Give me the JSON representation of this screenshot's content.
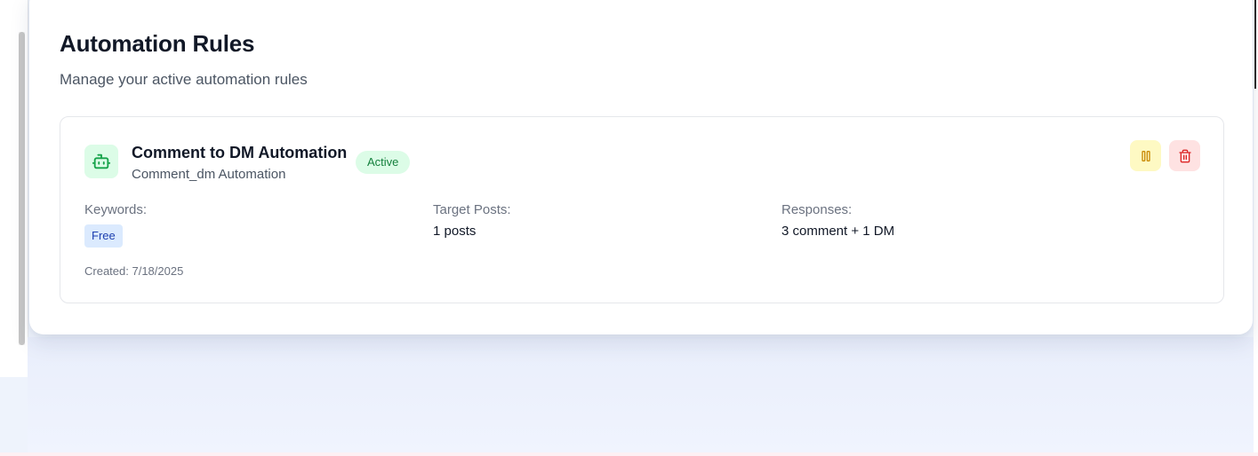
{
  "page": {
    "title": "Automation Rules",
    "subtitle": "Manage your active automation rules"
  },
  "rules": [
    {
      "name": "Comment to DM Automation",
      "type": "Comment_dm Automation",
      "status": "Active",
      "icon": "robot-icon",
      "keywords_label": "Keywords:",
      "keywords": [
        "Free"
      ],
      "target_posts_label": "Target Posts:",
      "target_posts_value": "1 posts",
      "responses_label": "Responses:",
      "responses_value": "3 comment + 1 DM",
      "created": "Created: 7/18/2025",
      "actions": [
        {
          "name": "pause",
          "icon": "pause-icon"
        },
        {
          "name": "delete",
          "icon": "trash-icon"
        }
      ]
    }
  ],
  "colors": {
    "active_badge_bg": "#dcfce7",
    "active_badge_text": "#15803d",
    "pause_bg": "#fef9c3",
    "pause_icon": "#ca8a04",
    "delete_bg": "#fee2e2",
    "delete_icon": "#dc2626",
    "keyword_chip_bg": "#dbeafe",
    "keyword_chip_text": "#1e40af"
  }
}
